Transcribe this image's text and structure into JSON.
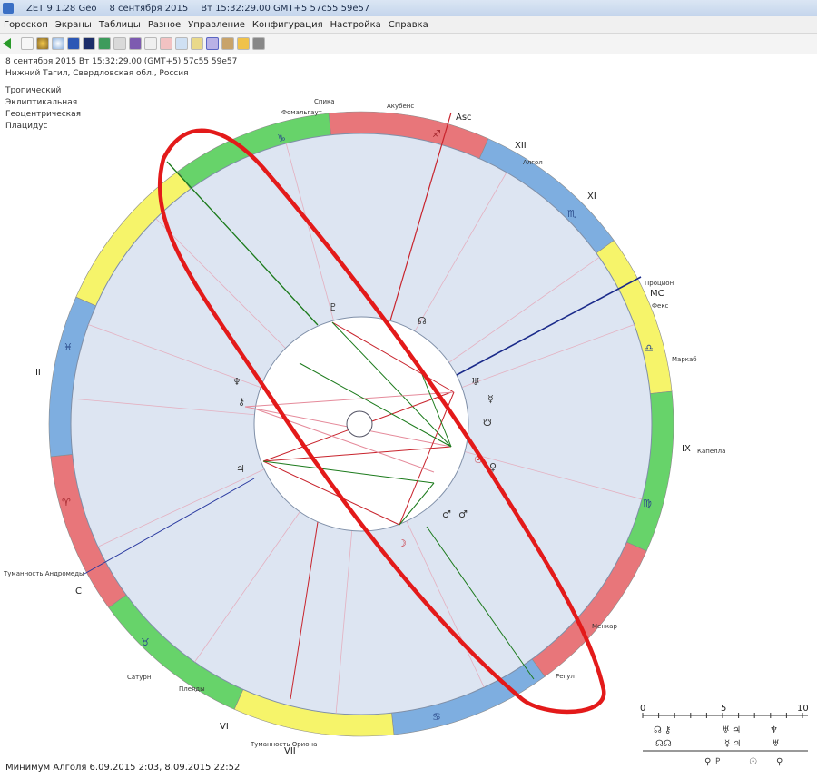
{
  "window": {
    "title": "ZET 9.1.28 Geo",
    "header_date": "8 сентября 2015",
    "header_time": "Вт 15:32:29.00 GMT+5 57c55 59e57"
  },
  "menu": [
    "Гороскоп",
    "Экраны",
    "Таблицы",
    "Разное",
    "Управление",
    "Конфигурация",
    "Настройка",
    "Справка"
  ],
  "toolbar": {
    "buttons": [
      "page-icon",
      "palette-icon",
      "globe-icon",
      "chart-blue-icon",
      "chart-navy-icon",
      "grid-icon",
      "calendar-icon",
      "book-icon",
      "table-icon",
      "table-red-icon",
      "document-icon",
      "stack-icon",
      "wheel-icon",
      "tools-icon",
      "warning-icon",
      "hand-icon"
    ]
  },
  "chart_info": {
    "line1": "8 сентября 2015  Вт  15:32:29.00 (GMT+5) 57c55  59e57",
    "line2": "Нижний Тагил, Свердловская обл., Россия",
    "line3": "Тропический",
    "line4": "Эклиптикальная",
    "line5": "Геоцентрическая",
    "line6": "Плацидус"
  },
  "wheel": {
    "asc_label": "Asc",
    "mc_label": "MC",
    "ic_label": "IC",
    "houses": [
      "XII",
      "XI",
      "III",
      "IX",
      "VI",
      "VII"
    ],
    "stars": {
      "spica": "Спика",
      "fomalhaut": "Фомальгаут",
      "acubens": "Акубенс",
      "algol": "Алгол",
      "procyon": "Процион",
      "markab": "Маркаб",
      "ferox": "Фекс",
      "menkar": "Менкар",
      "andromeda": "Туманность Андромеды",
      "capella": "Капелла",
      "saturn_star": "Сатурн",
      "pleiades": "Плеяды",
      "orion": "Туманность Ориона",
      "regulus": "Регул"
    },
    "sign_colors": [
      "#e8767a",
      "#7eaee0",
      "#f6f46a",
      "#67d36a"
    ]
  },
  "aspect_scale": {
    "ticks": [
      "0",
      "5",
      "10"
    ]
  },
  "status": {
    "text": "Минимум Алголя 6.09.2015  2:03,  8.09.2015 22:52"
  }
}
